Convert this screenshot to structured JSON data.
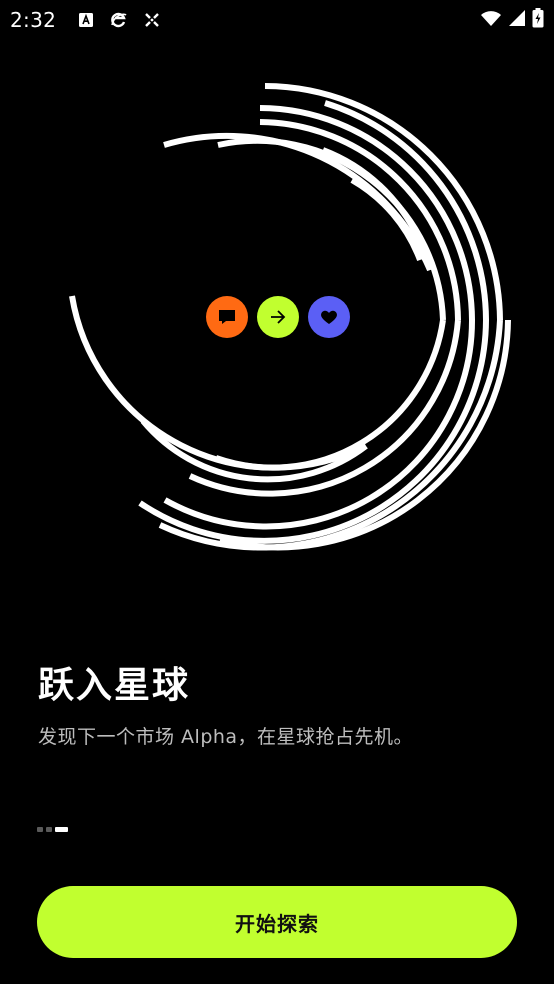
{
  "status_bar": {
    "time": "2:32",
    "left_icons": [
      "text-a-icon",
      "ie-icon",
      "crosshair-icon"
    ],
    "right_icons": [
      "wifi-icon",
      "signal-icon",
      "battery-icon"
    ]
  },
  "hero": {
    "icons": [
      {
        "name": "chat-icon",
        "color": "#ff6a13"
      },
      {
        "name": "arrow-right-icon",
        "color": "#c1ff2f"
      },
      {
        "name": "heart-icon",
        "color": "#5b5ff5"
      }
    ],
    "ring_color": "#ffffff"
  },
  "onboarding": {
    "title": "跃入星球",
    "subtitle": "发现下一个市场 Alpha，在星球抢占先机。",
    "pager": {
      "total": 3,
      "active_index": 2
    }
  },
  "cta": {
    "label": "开始探索",
    "color": "#c1ff2f"
  }
}
